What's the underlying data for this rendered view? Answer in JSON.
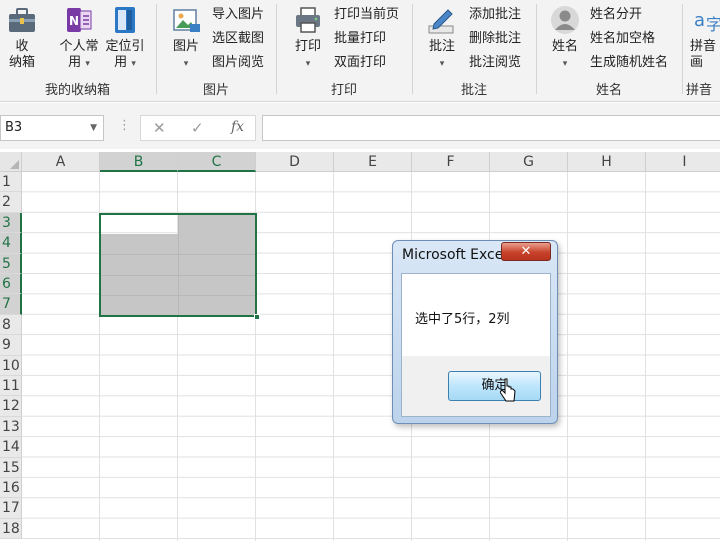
{
  "ribbon": {
    "group_my_box": {
      "btn_collect": "收\n纳箱",
      "btn_personal": "个人常\n用",
      "btn_locate": "定位引\n用",
      "label": "我的收纳箱"
    },
    "group_picture": {
      "btn_picture": "图片",
      "import_picture": "导入图片",
      "region_screenshot": "选区截图",
      "picture_view": "图片阅览",
      "label": "图片"
    },
    "group_print": {
      "btn_print": "打印",
      "print_current": "打印当前页",
      "batch_print": "批量打印",
      "duplex_print": "双面打印",
      "label": "打印"
    },
    "group_comment": {
      "btn_comment": "批注",
      "add_comment": "添加批注",
      "delete_comment": "删除批注",
      "view_comment": "批注阅览",
      "label": "批注"
    },
    "group_name": {
      "btn_name": "姓名",
      "split_name": "姓名分开",
      "name_spaces": "姓名加空格",
      "random_names": "生成随机姓名",
      "label": "姓名"
    },
    "group_pinyin": {
      "btn_pinyin": "拼音\n画",
      "label": "拼音"
    }
  },
  "formula_bar": {
    "name_box": "B3",
    "cancel_icon": "✕",
    "enter_icon": "✓",
    "fx_label": "fx",
    "formula": ""
  },
  "grid": {
    "columns": [
      "A",
      "B",
      "C",
      "D",
      "E",
      "F",
      "G",
      "H",
      "I"
    ],
    "rows": [
      "1",
      "2",
      "3",
      "4",
      "5",
      "6",
      "7",
      "8",
      "9",
      "10",
      "11",
      "12",
      "13",
      "14",
      "15",
      "16",
      "17",
      "18"
    ],
    "selected_columns": [
      "B",
      "C"
    ],
    "selected_rows": [
      "3",
      "4",
      "5",
      "6",
      "7"
    ],
    "active_cell": "B3"
  },
  "dialog": {
    "title": "Microsoft Excel",
    "close_label": "✕",
    "message": "选中了5行，2列",
    "ok_label": "确定"
  },
  "colors": {
    "accent_green": "#217346",
    "selection_gray": "#c6c6c6",
    "dialog_blue": "#bcd3ec",
    "close_red": "#c8412a"
  }
}
